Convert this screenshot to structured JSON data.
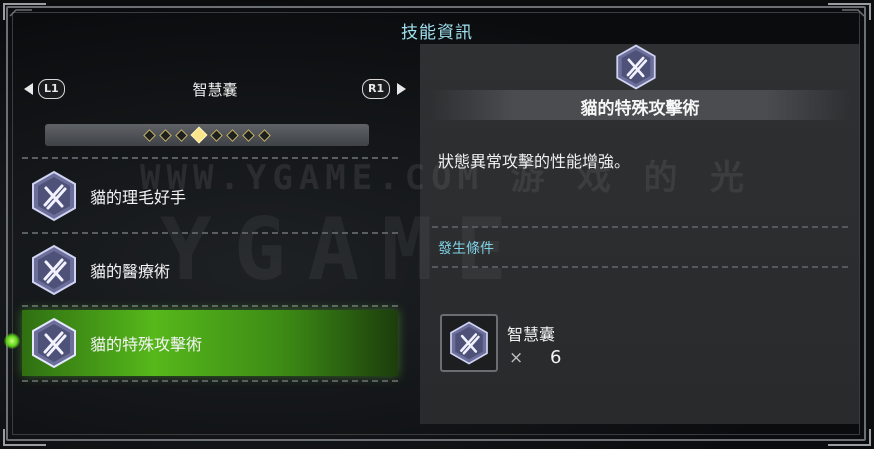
{
  "window": {
    "title": "技能資訊"
  },
  "category": {
    "prev_button": "L1",
    "next_button": "R1",
    "label": "智慧囊",
    "pages": 8,
    "active_page": 3
  },
  "skills": [
    {
      "label": "貓的理毛好手",
      "selected": false,
      "icon": "cat-skill-icon"
    },
    {
      "label": "貓的醫療術",
      "selected": false,
      "icon": "cat-skill-icon"
    },
    {
      "label": "貓的特殊攻擊術",
      "selected": true,
      "icon": "cat-skill-icon"
    }
  ],
  "detail": {
    "icon": "cat-skill-icon",
    "title": "貓的特殊攻擊術",
    "description": "狀態異常攻擊的性能增強。",
    "condition_header": "發生條件",
    "requirement": {
      "name": "智慧囊",
      "times": "×",
      "count": "6"
    }
  },
  "watermark": {
    "line1": "WWW.YGAME.COM 游 戏 的 光",
    "line2": "YGAME"
  },
  "colors": {
    "title": "#9fe0f0",
    "selected_row": "#56b81b",
    "condition": "#7fd2e6",
    "dot_active": "#fbe58a"
  }
}
